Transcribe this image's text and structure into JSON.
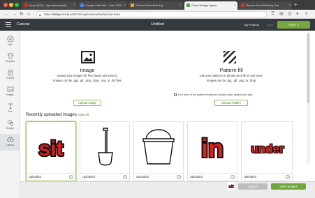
{
  "browser": {
    "tabs": [
      {
        "label": "Inbox (513) - dlpmatherhaat@",
        "favicon_color": "#d93025"
      },
      {
        "label": "Google Calendar - June 2018",
        "favicon_color": "#4285f4"
      },
      {
        "label": "Roman Word Building",
        "favicon_color": "#f0a030"
      },
      {
        "label": "Cricut Design Space",
        "favicon_color": "#5aa03c"
      },
      {
        "label": "Roman Word Building Tool",
        "favicon_color": "#d93025"
      }
    ],
    "url_prefix": "https://",
    "url_host": "design.cricut.com",
    "url_path": "/#/design/new/upload/upload-base",
    "new_tab": "+"
  },
  "header": {
    "menu_label": "Canvas",
    "title": "Untitled",
    "my_projects": "My Projects",
    "save": "Save",
    "make_it": "Make it"
  },
  "rail": [
    {
      "label": "New",
      "icon": "plus-icon"
    },
    {
      "label": "Templates",
      "icon": "shirt-icon"
    },
    {
      "label": "Projects",
      "icon": "folder-icon"
    },
    {
      "label": "Images",
      "icon": "image-icon"
    },
    {
      "label": "Text",
      "icon": "text-icon"
    },
    {
      "label": "Shapes",
      "icon": "shapes-icon"
    },
    {
      "label": "Upload",
      "icon": "upload-icon"
    }
  ],
  "upload": {
    "image": {
      "title": "Image",
      "line1": "Upload your images for free (basic and vector).",
      "line2": "Images can be .jpg, .gif, .png, .bmp, .svg, or .dxf files",
      "button": "Upload Image"
    },
    "pattern": {
      "title": "Pattern fill",
      "line1": "Use your patterns or photos as a fill on any layer.",
      "line2": "Images can be .jpg, .gif, .png, or .bmp",
      "checkbox": "Find them in the pattern fill attribute swatch under pattern print type.",
      "button": "Upload Pattern"
    }
  },
  "recent": {
    "title": "Recently uploaded images",
    "view_all": "View All",
    "items": [
      {
        "caption": "Uploaded",
        "word": "sit",
        "kind": "word"
      },
      {
        "caption": "Uploaded",
        "kind": "shovel"
      },
      {
        "caption": "Uploaded",
        "kind": "bucket"
      },
      {
        "caption": "Uploaded",
        "word": "in",
        "kind": "word"
      },
      {
        "caption": "Uploaded",
        "word": "under",
        "kind": "word"
      }
    ]
  },
  "footer": {
    "thumb_word": "sit",
    "cancel": "Cancel",
    "insert": "Insert Images"
  },
  "colors": {
    "accent_green": "#6da63a",
    "header_dark": "#353a40",
    "word_red": "#e01e1e"
  }
}
